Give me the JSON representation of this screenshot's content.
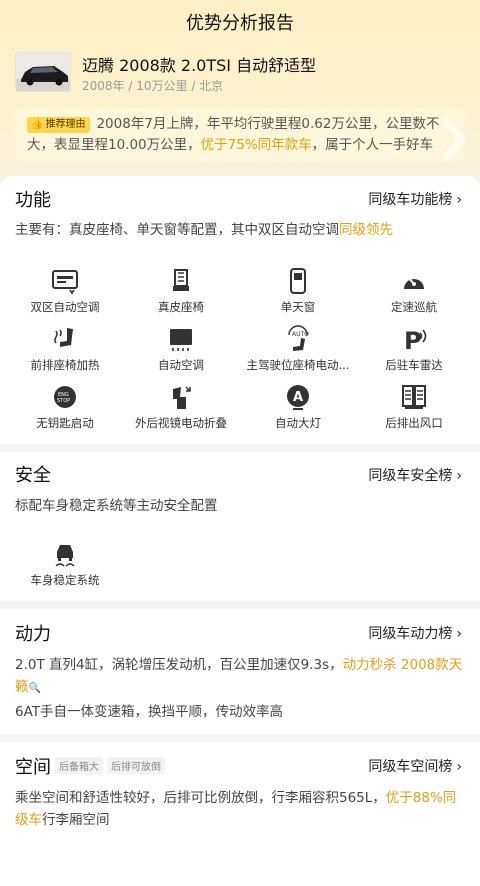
{
  "page_title": "优势分析报告",
  "car": {
    "name": "迈腾 2008款 2.0TSI 自动舒适型",
    "year": "2008年",
    "mileage": "10万公里",
    "city": "北京",
    "sep": " / "
  },
  "recommend": {
    "badge": "推荐理由",
    "text_a": "2008年7月上牌，年平均行驶里程0.62万公里，公里数不大，表显里程10.00万公里，",
    "text_hl": "优于75%同年款车",
    "text_b": "，属于个人一手好车"
  },
  "function": {
    "title": "功能",
    "link": "同级车功能榜",
    "desc_a": "主要有：真皮座椅、单天窗等配置，其中双区自动空调",
    "desc_hl": "同级领先",
    "features": [
      {
        "label": "双区自动空调",
        "icon": "ac-panel-icon"
      },
      {
        "label": "真皮座椅",
        "icon": "leather-seat-icon"
      },
      {
        "label": "单天窗",
        "icon": "sunroof-icon"
      },
      {
        "label": "定速巡航",
        "icon": "cruise-control-icon"
      },
      {
        "label": "前排座椅加热",
        "icon": "seat-heating-icon"
      },
      {
        "label": "自动空调",
        "icon": "auto-ac-icon"
      },
      {
        "label": "主驾驶位座椅电动...",
        "icon": "power-seat-icon"
      },
      {
        "label": "后驻车雷达",
        "icon": "parking-radar-icon"
      },
      {
        "label": "无钥匙启动",
        "icon": "keyless-start-icon"
      },
      {
        "label": "外后视镜电动折叠",
        "icon": "mirror-fold-icon"
      },
      {
        "label": "自动大灯",
        "icon": "auto-headlight-icon"
      },
      {
        "label": "后排出风口",
        "icon": "rear-vent-icon"
      }
    ]
  },
  "safety": {
    "title": "安全",
    "link": "同级车安全榜",
    "desc": "标配车身稳定系统等主动安全配置",
    "features": [
      {
        "label": "车身稳定系统",
        "icon": "stability-control-icon"
      }
    ]
  },
  "power": {
    "title": "动力",
    "link": "同级车动力榜",
    "desc_a": "2.0T 直列4缸，涡轮增压发动机，百公里加速仅9.3s，",
    "desc_hl": "动力秒杀 2008款天籁",
    "desc2": "6AT手自一体变速箱，换挡平顺，传动效率高"
  },
  "space": {
    "title": "空间",
    "tags": [
      "后备箱大",
      "后排可放倒"
    ],
    "link": "同级车空间榜",
    "desc_a": "乘坐空间和舒适性较好，后排可比例放倒，行李厢容积565L，",
    "desc_hl": "优于88%同级车",
    "desc_b": "行李厢空间"
  },
  "colors": {
    "accent": "#e2a112",
    "badge": "#fbd64a",
    "hero": "#fdf0c4"
  }
}
